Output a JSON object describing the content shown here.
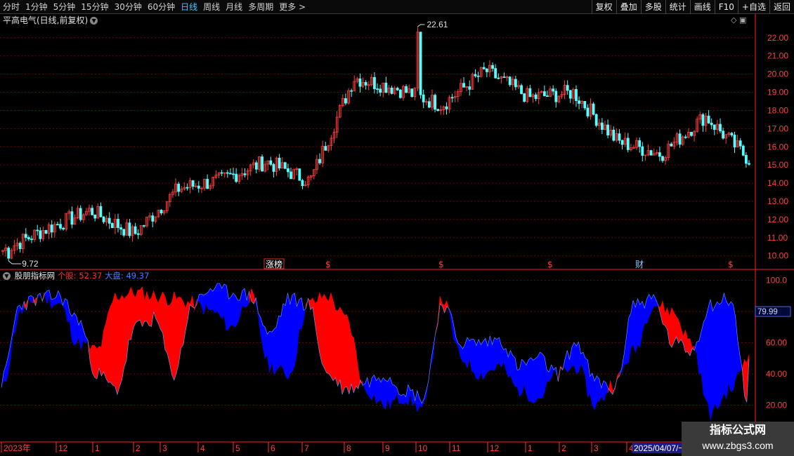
{
  "toolbar": {
    "periods": [
      "分时",
      "1分钟",
      "5分钟",
      "15分钟",
      "30分钟",
      "60分钟",
      "日线",
      "周线",
      "月线",
      "多周期",
      "更多 >"
    ],
    "active_period": "日线",
    "actions": [
      "复权",
      "叠加",
      "多股",
      "统计",
      "画线",
      "F10",
      "+自选",
      "返回"
    ]
  },
  "stock": {
    "title": "平高电气(日线,前复权)",
    "high_label": "22.61",
    "low_label": "9.72",
    "yaxis": [
      "22.00",
      "21.00",
      "20.00",
      "19.00",
      "18.00",
      "17.00",
      "16.00",
      "15.00",
      "14.00",
      "13.00",
      "12.00",
      "11.00",
      "10.00"
    ]
  },
  "markers": {
    "limit_up": "涨榜",
    "finance": "财",
    "dollar": "$"
  },
  "indicator": {
    "name": "股朋指标网",
    "stock_label": "个股:",
    "stock_value": "52.37",
    "market_label": "大盘:",
    "market_value": "49.37",
    "yaxis": [
      "100.0",
      "80.00",
      "60.00",
      "40.00",
      "20.00"
    ],
    "current_tag": "79.99"
  },
  "xaxis": {
    "labels": [
      "2023年",
      "12",
      "1",
      "2",
      "3",
      "4",
      "5",
      "6",
      "7",
      "8",
      "9",
      "10",
      "11",
      "12",
      "1",
      "2",
      "3",
      "4"
    ],
    "cursor_date": "2025/04/07/一"
  },
  "watermark": {
    "line1": "指标公式网",
    "line2": "www.zbgs3.com"
  },
  "colors": {
    "up": "#ff3c3c",
    "down": "#54ffff",
    "red_fill": "#ff0000",
    "blue_fill": "#0000ff",
    "grid": "#7a0000",
    "active_period": "#3ec6ff"
  },
  "chart_data": [
    {
      "type": "candlestick",
      "title": "平高电气(日线,前复权)",
      "y_range": [
        9.72,
        22.61
      ],
      "x": [
        "2023-11",
        "2023-12",
        "2024-01",
        "2024-02",
        "2024-03",
        "2024-04",
        "2024-05",
        "2024-06",
        "2024-07",
        "2024-08",
        "2024-09",
        "2024-10",
        "2024-11",
        "2024-12",
        "2025-01",
        "2025-02",
        "2025-03",
        "2025-04"
      ],
      "close_approx": [
        10.3,
        11.5,
        12.5,
        11.2,
        13.7,
        14.2,
        15.2,
        14.1,
        19.8,
        19.2,
        18.3,
        20.2,
        18.7,
        19.0,
        16.3,
        15.6,
        17.7,
        15.3
      ],
      "max": 22.61,
      "min": 9.72
    },
    {
      "type": "area",
      "title": "股朋指标网",
      "ylim": [
        0,
        100
      ],
      "series": [
        {
          "name": "个股",
          "last": 52.37,
          "color": "#ff0000",
          "values": [
            30,
            80,
            90,
            85,
            60,
            55,
            90,
            92,
            90,
            88,
            85,
            80,
            70,
            90,
            45,
            40,
            85,
            90,
            75,
            30,
            20,
            25,
            18,
            88,
            50,
            40,
            45,
            30,
            25,
            40,
            45,
            20,
            35,
            55,
            85,
            80,
            60,
            15,
            30,
            52
          ]
        },
        {
          "name": "大盘",
          "last": 49.37,
          "color": "#0000ff",
          "values": [
            35,
            85,
            88,
            90,
            75,
            40,
            30,
            70,
            75,
            40,
            85,
            95,
            92,
            90,
            65,
            88,
            85,
            40,
            30,
            35,
            40,
            30,
            25,
            85,
            60,
            60,
            62,
            45,
            50,
            40,
            60,
            35,
            30,
            85,
            88,
            60,
            55,
            85,
            88,
            20
          ]
        }
      ]
    }
  ]
}
